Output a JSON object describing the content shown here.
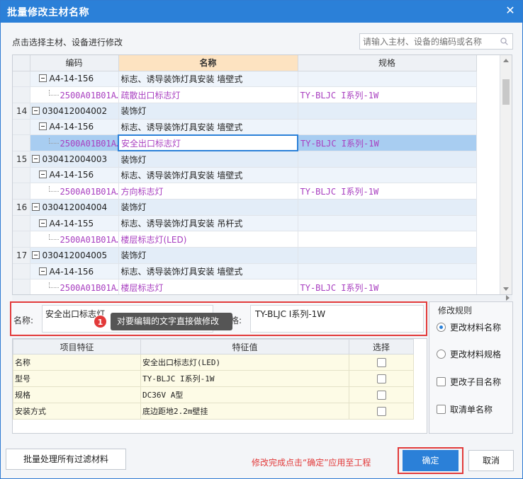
{
  "window": {
    "title": "批量修改主材名称",
    "close_symbol": "✕"
  },
  "hint": "点击选择主材、设备进行修改",
  "search": {
    "placeholder": "请输入主材、设备的编码或名称"
  },
  "grid": {
    "headers": {
      "code": "编码",
      "name": "名称",
      "spec": "规格"
    },
    "rows": [
      {
        "level": 2,
        "num": "",
        "code": "A4-14-156",
        "name": "标志、诱导装饰灯具安装 墙壁式",
        "spec": ""
      },
      {
        "level": 3,
        "num": "",
        "code": "2500A01B01A…",
        "name": "疏散出口标志灯",
        "spec": "TY-BLJC I系列-1W"
      },
      {
        "level": 1,
        "num": "14",
        "code": "030412004002",
        "name": "装饰灯",
        "spec": ""
      },
      {
        "level": 2,
        "num": "",
        "code": "A4-14-156",
        "name": "标志、诱导装饰灯具安装 墙壁式",
        "spec": ""
      },
      {
        "level": 3,
        "num": "",
        "code": "2500A01B01A…",
        "name": "安全出口标志灯",
        "spec": "TY-BLJC I系列-1W",
        "current": true
      },
      {
        "level": 1,
        "num": "15",
        "code": "030412004003",
        "name": "装饰灯",
        "spec": ""
      },
      {
        "level": 2,
        "num": "",
        "code": "A4-14-156",
        "name": "标志、诱导装饰灯具安装 墙壁式",
        "spec": ""
      },
      {
        "level": 3,
        "num": "",
        "code": "2500A01B01A…",
        "name": "方向标志灯",
        "spec": "TY-BLJC I系列-1W"
      },
      {
        "level": 1,
        "num": "16",
        "code": "030412004004",
        "name": "装饰灯",
        "spec": ""
      },
      {
        "level": 2,
        "num": "",
        "code": "A4-14-155",
        "name": "标志、诱导装饰灯具安装 吊杆式",
        "spec": ""
      },
      {
        "level": 3,
        "num": "",
        "code": "2500A01B01A…",
        "name": "楼层标志灯(LED)",
        "spec": ""
      },
      {
        "level": 1,
        "num": "17",
        "code": "030412004005",
        "name": "装饰灯",
        "spec": ""
      },
      {
        "level": 2,
        "num": "",
        "code": "A4-14-156",
        "name": "标志、诱导装饰灯具安装 墙壁式",
        "spec": ""
      },
      {
        "level": 3,
        "num": "",
        "code": "2500A01B01A…",
        "name": "楼层标志灯",
        "spec": "TY-BLJC I系列-1W"
      }
    ]
  },
  "edit": {
    "name_label": "名称:",
    "name_value": "安全出口标志灯",
    "spec_label": "规格:",
    "spec_value": "TY-BLJC I系列-1W"
  },
  "tooltip": {
    "badge": "1",
    "text": "对要编辑的文字直接做修改"
  },
  "features": {
    "headers": {
      "item": "项目特征",
      "value": "特征值",
      "select": "选择"
    },
    "rows": [
      {
        "item": "名称",
        "value": "安全出口标志灯(LED)"
      },
      {
        "item": "型号",
        "value": "TY-BLJC I系列-1W"
      },
      {
        "item": "规格",
        "value": "DC36V A型"
      },
      {
        "item": "安装方式",
        "value": "底边距地2.2m壁挂"
      }
    ]
  },
  "rules": {
    "title": "修改规则",
    "options": [
      "更改材料名称",
      "更改材料规格"
    ],
    "selected": "更改材料名称",
    "checks": [
      "更改子目名称",
      "取清单名称"
    ]
  },
  "buttons": {
    "batch": "批量处理所有过滤材料",
    "ok": "确定",
    "cancel": "取消"
  },
  "footnote": "修改完成点击“确定”应用至工程"
}
